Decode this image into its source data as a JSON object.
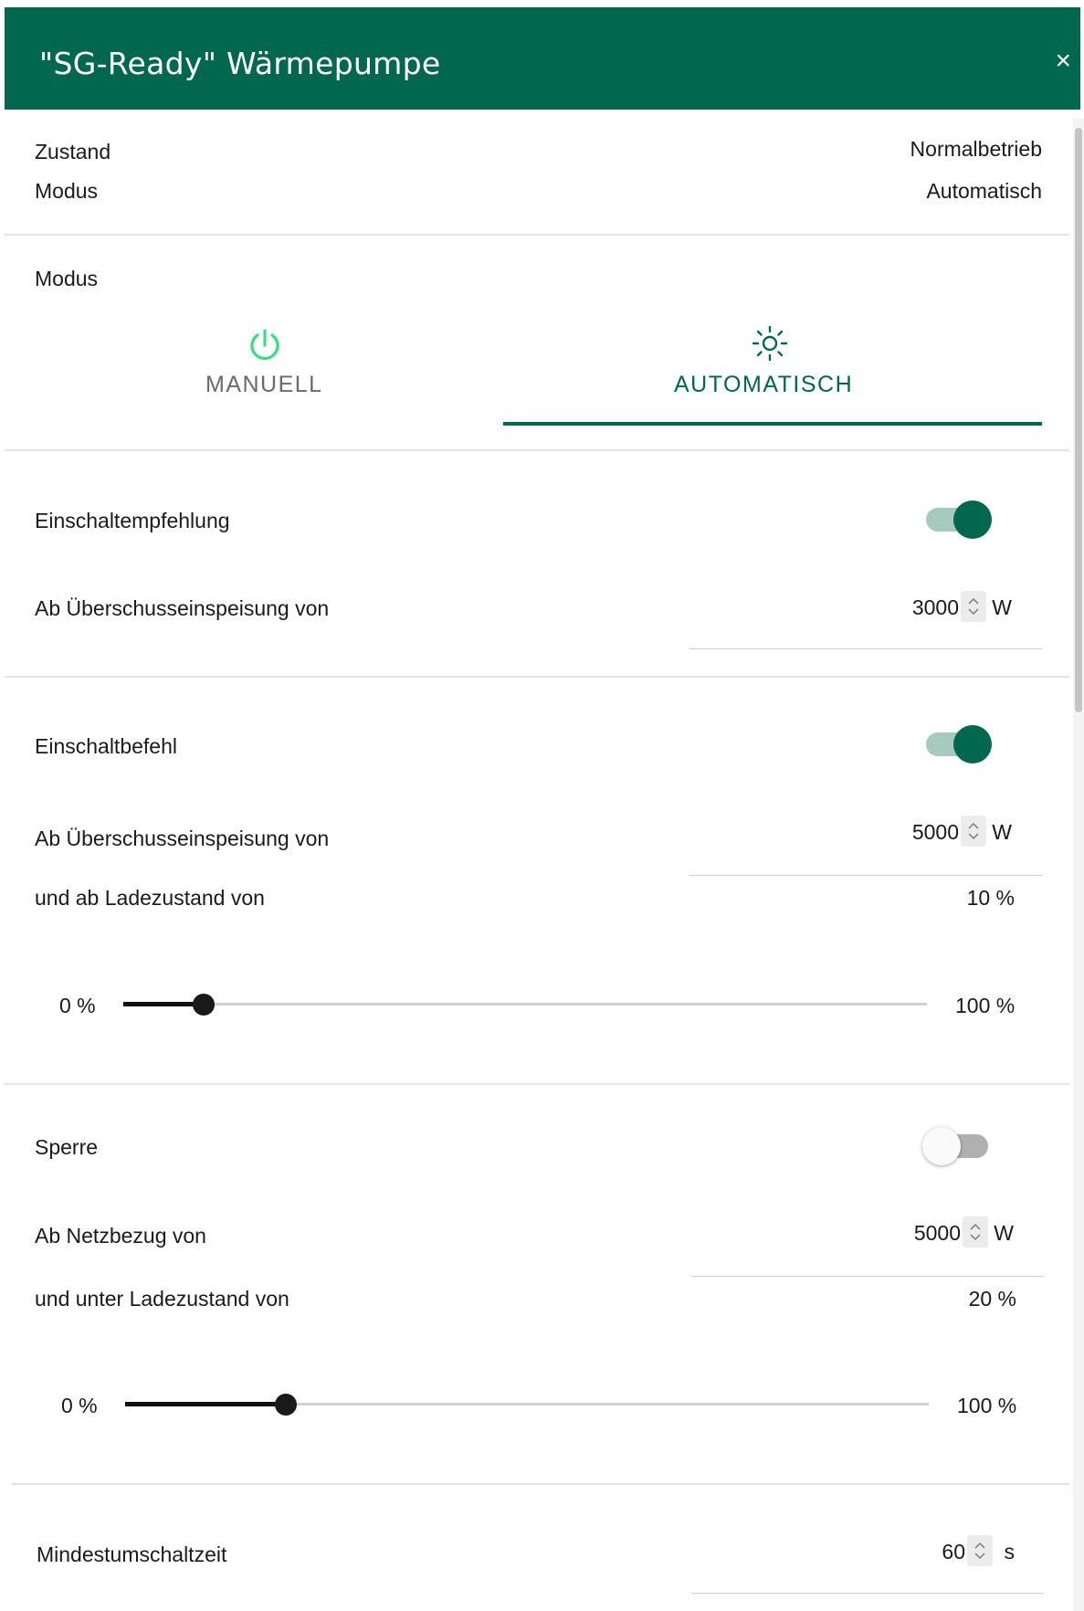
{
  "dialog": {
    "title": "\"SG-Ready\" Wärmepumpe",
    "close_symbol": "×"
  },
  "status": {
    "zustand_label": "Zustand",
    "zustand_value": "Normalbetrieb",
    "modus_label": "Modus",
    "modus_value": "Automatisch"
  },
  "mode_selector": {
    "label": "Modus",
    "tabs": [
      {
        "label": "MANUELL",
        "icon": "power-icon",
        "icon_color": "#3ddc84"
      },
      {
        "label": "AUTOMATISCH",
        "icon": "sun-icon",
        "selected": true
      }
    ],
    "accent": "#02674f"
  },
  "einschaltempfehlung": {
    "label": "Einschaltempfehlung",
    "enabled": true,
    "threshold_label": "Ab Überschusseinspeisung von",
    "threshold_value": "3000",
    "threshold_unit": "W"
  },
  "einschaltbefehl": {
    "label": "Einschaltbefehl",
    "enabled": true,
    "threshold_label": "Ab Überschusseinspeisung von",
    "threshold_value": "5000",
    "threshold_unit": "W",
    "soc_label": "und ab Ladezustand von",
    "soc_value": "10 %",
    "slider_min": "0 %",
    "slider_max": "100 %",
    "slider_percent": 10
  },
  "sperre": {
    "label": "Sperre",
    "enabled": false,
    "threshold_label": "Ab Netzbezug von",
    "threshold_value": "5000",
    "threshold_unit": "W",
    "soc_label": "und unter Ladezustand von",
    "soc_value": "20 %",
    "slider_min": "0 %",
    "slider_max": "100 %",
    "slider_percent": 20
  },
  "mindestumschaltzeit": {
    "label": "Mindestumschaltzeit",
    "value": "60",
    "unit": "s"
  }
}
